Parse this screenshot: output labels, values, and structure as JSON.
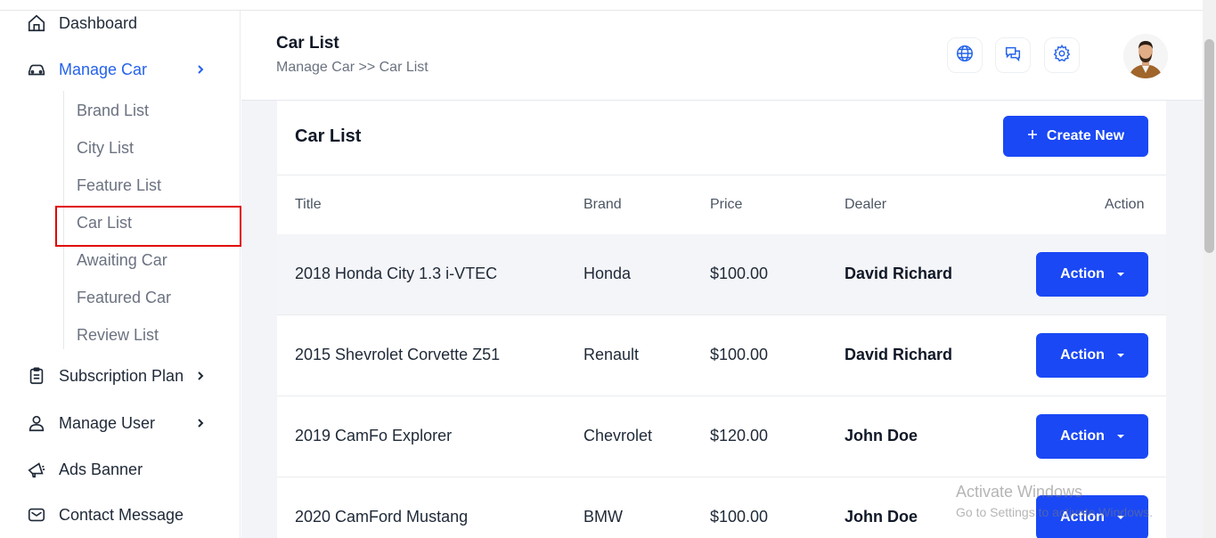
{
  "sidebar": {
    "dashboard": "Dashboard",
    "manage_car": "Manage Car",
    "sub_items": [
      "Brand List",
      "City List",
      "Feature List",
      "Car List",
      "Awaiting Car",
      "Featured Car",
      "Review List"
    ],
    "subscription_plan": "Subscription Plan",
    "manage_user": "Manage User",
    "ads_banner": "Ads Banner",
    "contact_message": "Contact Message"
  },
  "header": {
    "title": "Car List",
    "breadcrumb": "Manage Car >> Car List"
  },
  "card": {
    "title": "Car List",
    "create_button": "Create New",
    "columns": {
      "title": "Title",
      "brand": "Brand",
      "price": "Price",
      "dealer": "Dealer",
      "action": "Action"
    },
    "action_label": "Action",
    "rows": [
      {
        "title": "2018 Honda City 1.3 i-VTEC",
        "brand": "Honda",
        "price": "$100.00",
        "dealer": "David Richard"
      },
      {
        "title": "2015 Shevrolet Corvette Z51",
        "brand": "Renault",
        "price": "$100.00",
        "dealer": "David Richard"
      },
      {
        "title": "2019 CamFo Explorer",
        "brand": "Chevrolet",
        "price": "$120.00",
        "dealer": "John Doe"
      },
      {
        "title": "2020 CamFord Mustang",
        "brand": "BMW",
        "price": "$100.00",
        "dealer": "John Doe"
      }
    ]
  },
  "watermark": {
    "title": "Activate Windows",
    "subtitle": "Go to Settings to activate Windows."
  },
  "colors": {
    "primary": "#1a48f5",
    "active_link": "#2563eb",
    "highlight_border": "#e00000"
  }
}
